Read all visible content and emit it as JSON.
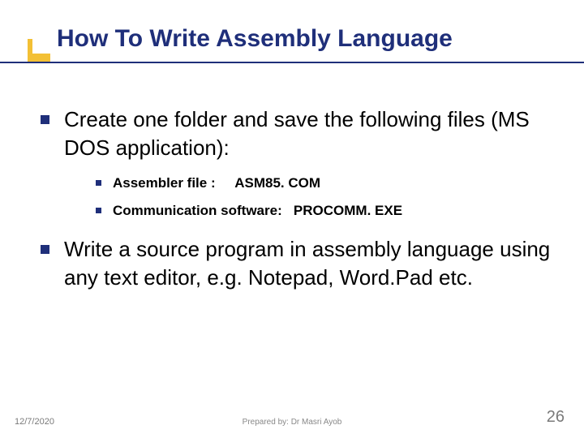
{
  "title": "How To Write Assembly Language",
  "bullets": {
    "b1": "Create one folder and save the following files (MS DOS application):",
    "b1a": "Assembler file :     ASM85. COM",
    "b1b": "Communication software:   PROCOMM. EXE",
    "b2": "Write a source program in assembly language using any text editor, e.g. Notepad, Word.Pad etc."
  },
  "footer": {
    "date": "12/7/2020",
    "prepared": "Prepared by: Dr Masri Ayob",
    "page": "26"
  }
}
